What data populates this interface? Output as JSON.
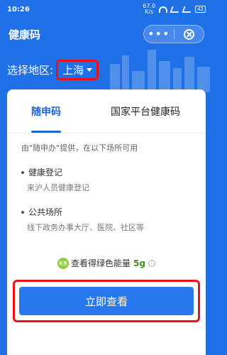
{
  "status": {
    "time": "10:26",
    "speed_value": "67.0",
    "speed_unit": "K/s",
    "battery": "42"
  },
  "header": {
    "title": "健康码",
    "more": "•••"
  },
  "region": {
    "label": "选择地区:",
    "value": "上海"
  },
  "tabs": [
    {
      "label": "随申码"
    },
    {
      "label": "国家平台健康码"
    }
  ],
  "content": {
    "description": "由\"随申办\"提供，在以下场所可用",
    "items": [
      {
        "title": "健康登记",
        "subtitle": "来沪人员健康登记"
      },
      {
        "title": "公共场所",
        "subtitle": "线下政务办事大厅、医院、社区等"
      }
    ],
    "energy": {
      "badge": "能量",
      "text": "查看得绿色能量",
      "value": "5g",
      "info": "i"
    },
    "button_label": "立即查看"
  },
  "colors": {
    "primary_blue": "#1f6fe6",
    "highlight_red": "#e8131a",
    "energy_green": "#3d8f1f"
  }
}
